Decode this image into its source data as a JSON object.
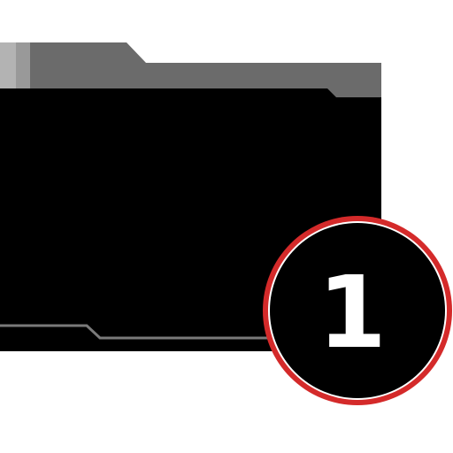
{
  "icon": {
    "name": "folder-icon",
    "colors": {
      "tab_light": "#b3b3b3",
      "tab_mid": "#999999",
      "tab_dark": "#6b6b6b",
      "body": "#000000",
      "trim": "#7a7a7a"
    }
  },
  "badge": {
    "count": "1",
    "colors": {
      "fill": "#000000",
      "ring": "#d42a2a",
      "ring_inner": "#ffffff",
      "text": "#ffffff"
    }
  }
}
